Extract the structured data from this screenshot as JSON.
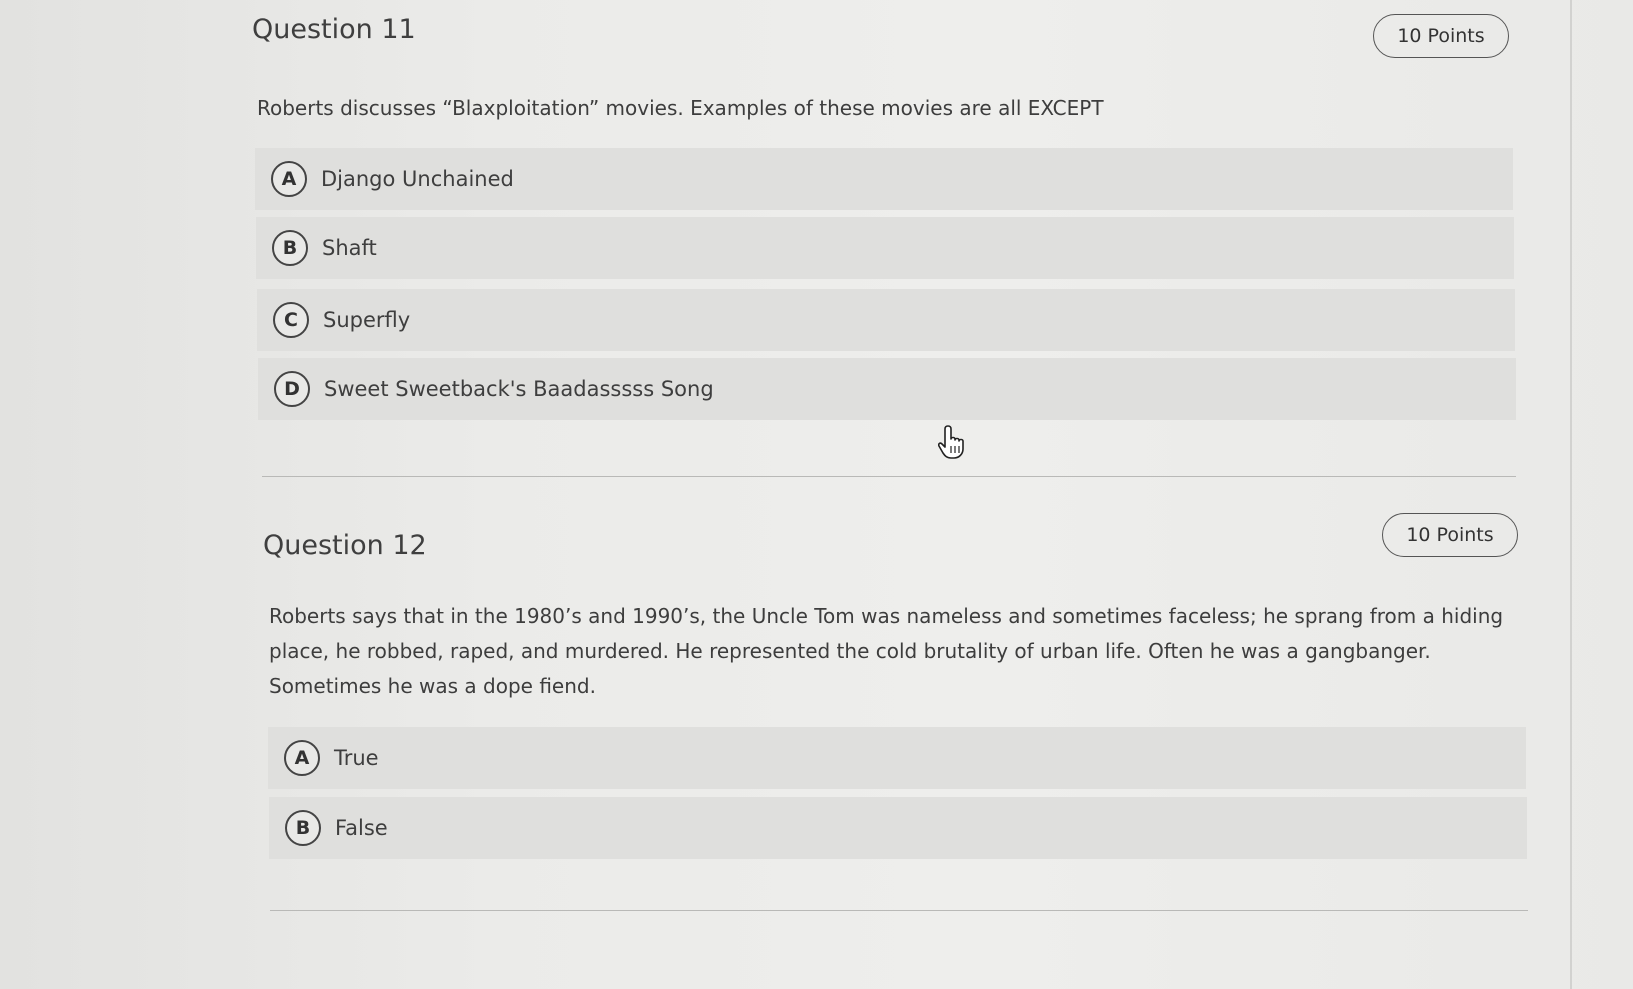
{
  "questions": [
    {
      "title": "Question 11",
      "points": "10 Points",
      "text": "Roberts discusses “Blaxploitation” movies. Examples of these movies are all EXCEPT",
      "options": [
        {
          "letter": "A",
          "label": "Django Unchained"
        },
        {
          "letter": "B",
          "label": "Shaft"
        },
        {
          "letter": "C",
          "label": "Superfly"
        },
        {
          "letter": "D",
          "label": "Sweet Sweetback's Baadasssss Song"
        }
      ]
    },
    {
      "title": "Question 12",
      "points": "10 Points",
      "text": "Roberts says that in the 1980’s and 1990’s, the Uncle Tom was nameless and sometimes faceless; he sprang from a hiding place, he robbed, raped, and murdered. He represented the cold brutality of urban life. Often he was a gangbanger. Sometimes he was a dope fiend.",
      "options": [
        {
          "letter": "A",
          "label": "True"
        },
        {
          "letter": "B",
          "label": "False"
        }
      ]
    }
  ],
  "cursor": {
    "icon": "hand-pointer-icon"
  }
}
